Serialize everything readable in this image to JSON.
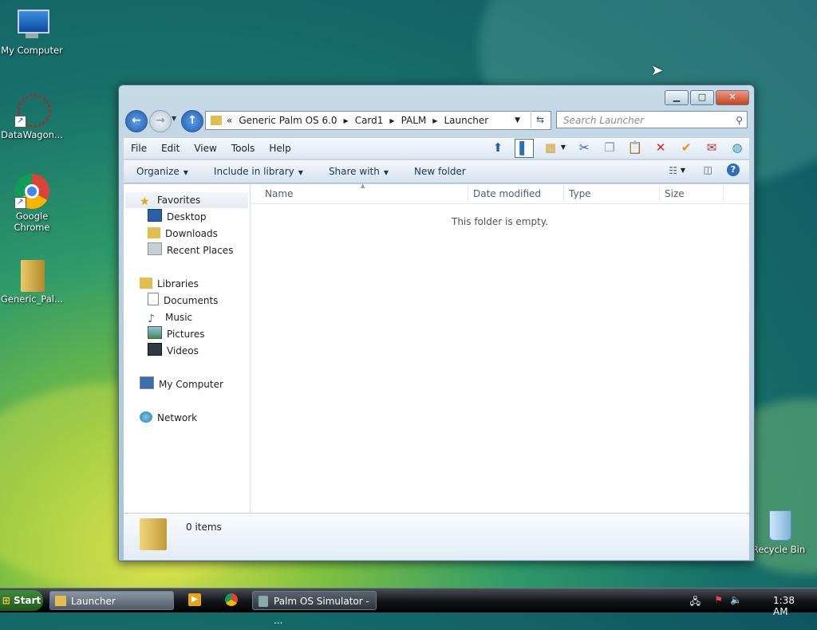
{
  "desktop": {
    "icons": [
      {
        "label": "My Computer"
      },
      {
        "label": "DataWagon..."
      },
      {
        "label": "Google Chrome",
        "line1": "Google",
        "line2": "Chrome"
      },
      {
        "label": "Generic_Pal..."
      },
      {
        "label": "Recycle Bin"
      }
    ]
  },
  "window": {
    "address": {
      "overflow_glyph": "«",
      "crumbs": [
        "Generic Palm OS 6.0",
        "Card1",
        "PALM",
        "Launcher"
      ]
    },
    "search_placeholder": "Search Launcher",
    "menu": [
      "File",
      "Edit",
      "View",
      "Tools",
      "Help"
    ],
    "commands": {
      "organize": "Organize",
      "include": "Include in library",
      "share": "Share with",
      "new_folder": "New folder"
    },
    "nav": {
      "favorites": "Favorites",
      "desktop": "Desktop",
      "downloads": "Downloads",
      "recent": "Recent Places",
      "libraries": "Libraries",
      "documents": "Documents",
      "music": "Music",
      "pictures": "Pictures",
      "videos": "Videos",
      "computer": "My Computer",
      "network": "Network"
    },
    "columns": [
      "Name",
      "Date modified",
      "Type",
      "Size"
    ],
    "empty_message": "This folder is empty.",
    "item_count": "0 items"
  },
  "taskbar": {
    "start": "Start",
    "task_launcher": "Launcher",
    "task_palm": "Palm OS Simulator - ...",
    "clock": "1:38 AM"
  },
  "colors": {
    "accent": "#2d6fb8",
    "close": "#c8411f"
  }
}
